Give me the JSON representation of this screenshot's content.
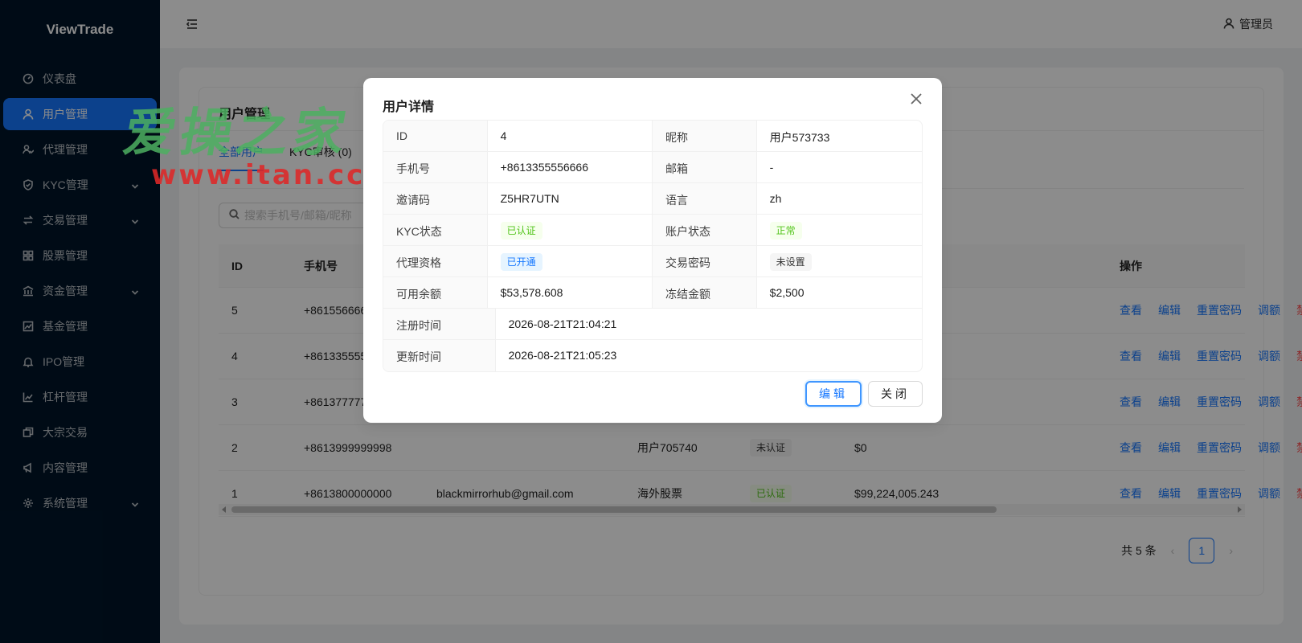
{
  "app": {
    "logo": "ViewTrade"
  },
  "sidebar": {
    "items": [
      {
        "label": "仪表盘",
        "icon": "dashboard-icon",
        "has_children": false,
        "active": false
      },
      {
        "label": "用户管理",
        "icon": "user-icon",
        "has_children": false,
        "active": true
      },
      {
        "label": "代理管理",
        "icon": "agent-icon",
        "has_children": false,
        "active": false
      },
      {
        "label": "KYC管理",
        "icon": "shield-icon",
        "has_children": true,
        "active": false
      },
      {
        "label": "交易管理",
        "icon": "swap-icon",
        "has_children": true,
        "active": false
      },
      {
        "label": "股票管理",
        "icon": "grid-icon",
        "has_children": false,
        "active": false
      },
      {
        "label": "资金管理",
        "icon": "bank-icon",
        "has_children": true,
        "active": false
      },
      {
        "label": "基金管理",
        "icon": "fund-chart-icon",
        "has_children": false,
        "active": false
      },
      {
        "label": "IPO管理",
        "icon": "bell-icon",
        "has_children": false,
        "active": false
      },
      {
        "label": "杠杆管理",
        "icon": "line-chart-icon",
        "has_children": false,
        "active": false
      },
      {
        "label": "大宗交易",
        "icon": "block-icon",
        "has_children": false,
        "active": false
      },
      {
        "label": "内容管理",
        "icon": "megaphone-icon",
        "has_children": false,
        "active": false
      },
      {
        "label": "系统管理",
        "icon": "settings-icon",
        "has_children": true,
        "active": false
      }
    ]
  },
  "header": {
    "user_label": "管理员"
  },
  "page": {
    "title": "用户管理",
    "tabs": [
      {
        "label": "全部用户",
        "active": true
      },
      {
        "label": "KYC审核 (0)",
        "active": false
      }
    ],
    "search_placeholder": "搜索手机号/邮箱/昵称"
  },
  "table": {
    "columns": {
      "id": "ID",
      "phone": "手机号",
      "ops": "操作"
    },
    "ops_labels": {
      "view": "查看",
      "edit": "编辑",
      "reset": "重置密码",
      "adjust": "调额",
      "disable": "禁用"
    },
    "rows": [
      {
        "id": "5",
        "phone": "+861556666",
        "email": "",
        "nickname": "",
        "kyc": "",
        "balance": ""
      },
      {
        "id": "4",
        "phone": "+861335555",
        "email": "",
        "nickname": "",
        "kyc": "",
        "balance": ""
      },
      {
        "id": "3",
        "phone": "+861377777",
        "email": "",
        "nickname": "",
        "kyc": "",
        "balance": ""
      },
      {
        "id": "2",
        "phone": "+8613999999998",
        "email": "",
        "nickname": "用户705740",
        "kyc": "未认证",
        "balance": "$0"
      },
      {
        "id": "1",
        "phone": "+8613800000000",
        "email": "blackmirrorhub@gmail.com",
        "nickname": "海外股票",
        "kyc": "已认证",
        "balance": "$99,224,005.243"
      }
    ]
  },
  "pagination": {
    "total_label": "共 5 条",
    "current_page": "1"
  },
  "watermark": {
    "cn": "爱操之家",
    "url": "www.itan.cc"
  },
  "modal": {
    "title": "用户详情",
    "fields": {
      "id_label": "ID",
      "id_value": "4",
      "nickname_label": "昵称",
      "nickname_value": "用户573733",
      "phone_label": "手机号",
      "phone_value": "+8613355556666",
      "email_label": "邮箱",
      "email_value": "-",
      "invite_label": "邀请码",
      "invite_value": "Z5HR7UTN",
      "lang_label": "语言",
      "lang_value": "zh",
      "kyc_label": "KYC状态",
      "kyc_value": "已认证",
      "account_label": "账户状态",
      "account_value": "正常",
      "agent_label": "代理资格",
      "agent_value": "已开通",
      "tradepw_label": "交易密码",
      "tradepw_value": "未设置",
      "avail_label": "可用余额",
      "avail_value": "$53,578.608",
      "frozen_label": "冻结金额",
      "frozen_value": "$2,500",
      "reg_label": "注册时间",
      "reg_value": "2026-08-21T21:04:21",
      "upd_label": "更新时间",
      "upd_value": "2026-08-21T21:05:23"
    },
    "edit_button": "编辑",
    "close_button": "关闭"
  }
}
